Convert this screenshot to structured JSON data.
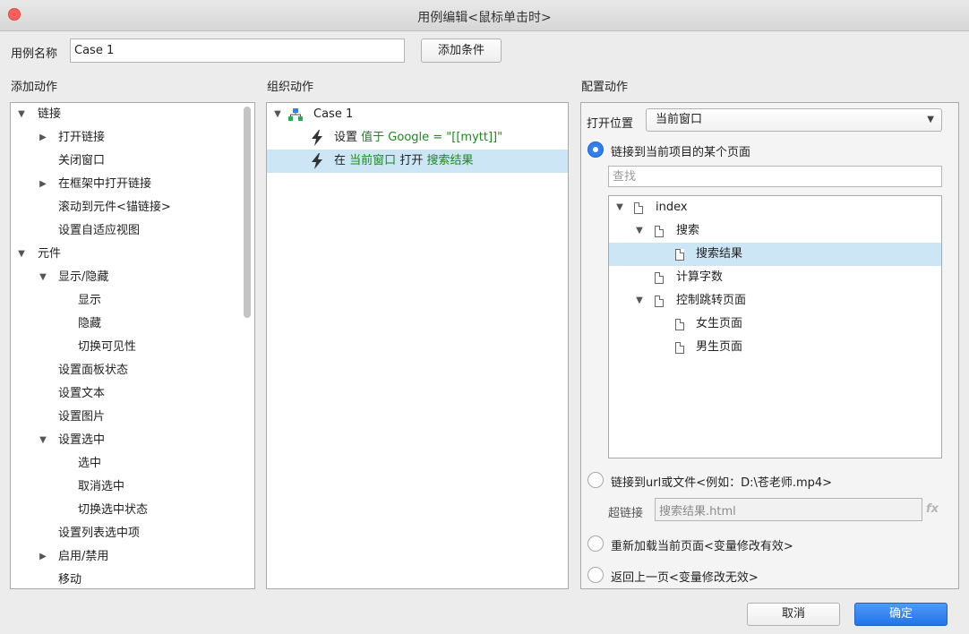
{
  "window": {
    "title": "用例编辑<鼠标单击时>"
  },
  "header": {
    "case_name_label": "用例名称",
    "case_name_value": "Case 1",
    "add_condition_button": "添加条件"
  },
  "add_actions": {
    "heading": "添加动作",
    "items": [
      {
        "label": "链接",
        "expanded": true
      },
      {
        "label": "打开链接",
        "expanded": false
      },
      {
        "label": "关闭窗口"
      },
      {
        "label": "在框架中打开链接",
        "expanded": false
      },
      {
        "label": "滚动到元件<锚链接>"
      },
      {
        "label": "设置自适应视图"
      },
      {
        "label": "元件",
        "expanded": true
      },
      {
        "label": "显示/隐藏",
        "expanded": true
      },
      {
        "label": "显示"
      },
      {
        "label": "隐藏"
      },
      {
        "label": "切换可见性"
      },
      {
        "label": "设置面板状态"
      },
      {
        "label": "设置文本"
      },
      {
        "label": "设置图片"
      },
      {
        "label": "设置选中",
        "expanded": true
      },
      {
        "label": "选中"
      },
      {
        "label": "取消选中"
      },
      {
        "label": "切换选中状态"
      },
      {
        "label": "设置列表选中项"
      },
      {
        "label": "启用/禁用",
        "expanded": false
      },
      {
        "label": "移动"
      }
    ]
  },
  "organize_actions": {
    "heading": "组织动作",
    "case_label": "Case 1",
    "actions": [
      {
        "verb": "设置",
        "detail": "值于 Google = \"[[mytt]]\""
      },
      {
        "verb": "在",
        "detail1": "当前窗口",
        "mid": "打开",
        "detail2": "搜索结果"
      }
    ]
  },
  "configure_actions": {
    "heading": "配置动作",
    "open_in_label": "打开位置",
    "open_in_value": "当前窗口",
    "option_page": "链接到当前项目的某个页面",
    "search_placeholder": "查找",
    "pages": [
      {
        "label": "index",
        "expanded": true
      },
      {
        "label": "搜索",
        "expanded": true
      },
      {
        "label": "搜索结果",
        "selected": true
      },
      {
        "label": "计算字数"
      },
      {
        "label": "控制跳转页面",
        "expanded": true
      },
      {
        "label": "女生页面"
      },
      {
        "label": "男生页面"
      }
    ],
    "option_url": "链接到url或文件<例如：D:\\苍老师.mp4>",
    "hyperlink_label": "超链接",
    "hyperlink_value": "搜索结果.html",
    "fx_label": "fx",
    "option_reload": "重新加载当前页面<变量修改有效>",
    "option_back": "返回上一页<变量修改无效>"
  },
  "footer": {
    "cancel": "取消",
    "ok": "确定"
  },
  "colors": {
    "accent": "#2f7fef",
    "selection": "#cce6f6",
    "variable_text": "#1a8a1a",
    "close": "#fc605c"
  }
}
